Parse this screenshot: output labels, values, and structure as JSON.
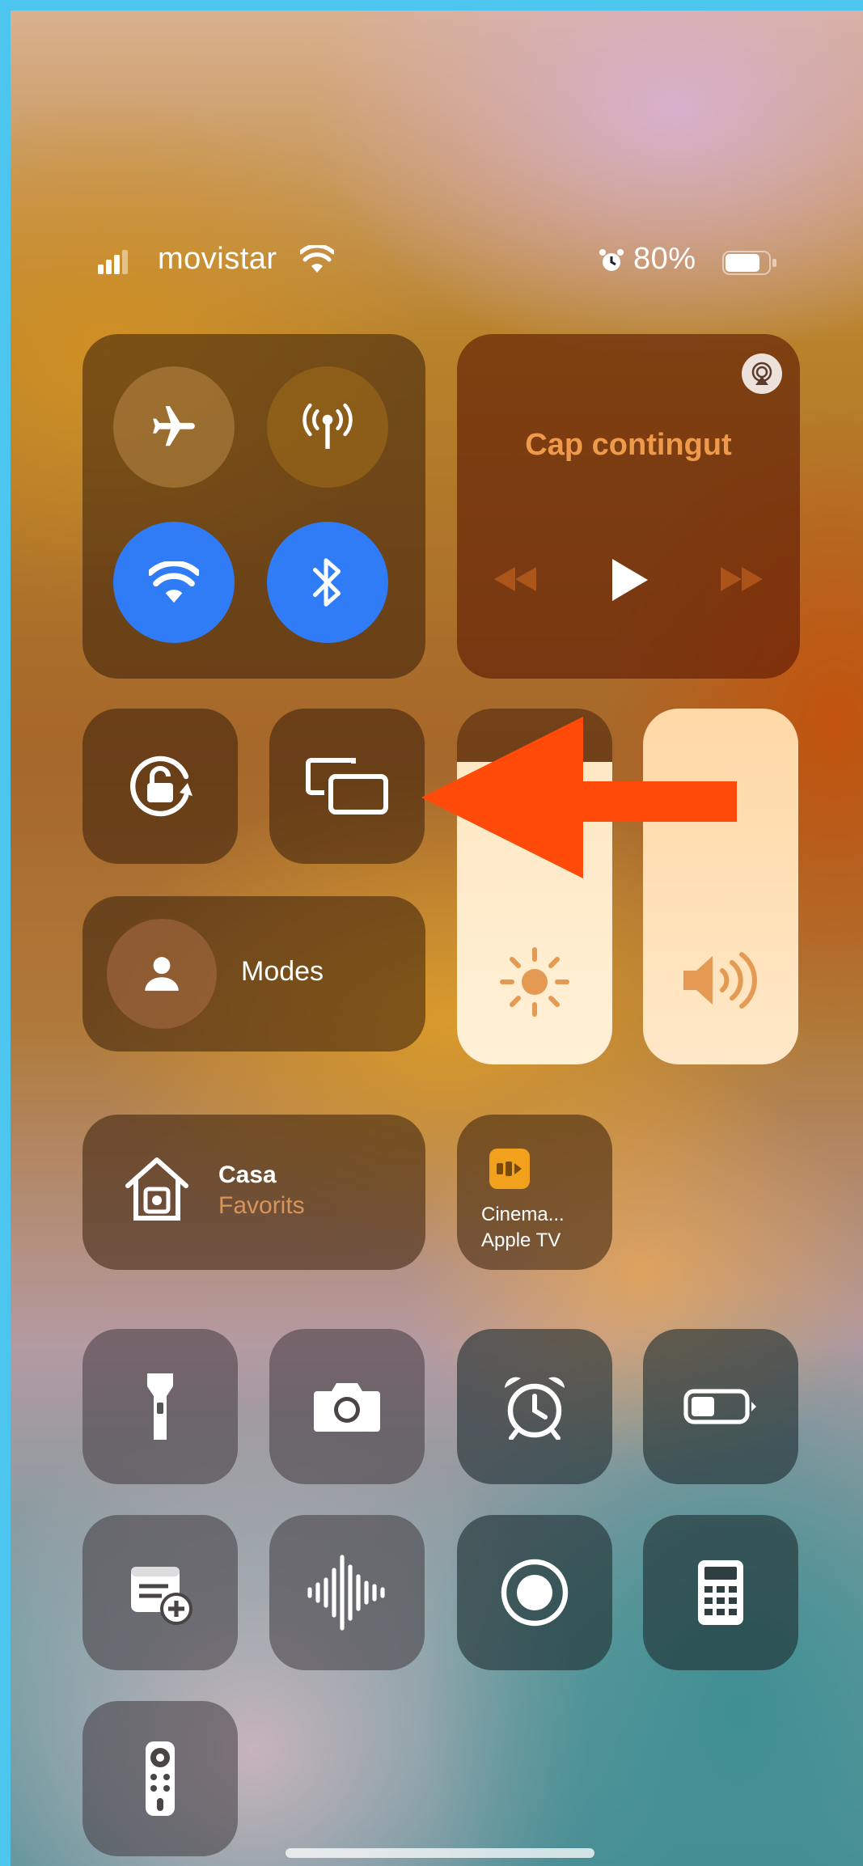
{
  "status_bar": {
    "carrier": "movistar",
    "battery_percent": "80%",
    "signal_bars": 3,
    "battery_level": 0.8
  },
  "connectivity": {
    "airplane_mode": false,
    "cellular_data": false,
    "wifi": true,
    "bluetooth": true,
    "active_color": "#2f7cf6"
  },
  "media": {
    "title": "Cap contingut",
    "title_color": "#ee9a4a"
  },
  "modes": {
    "label": "Modes"
  },
  "home": {
    "title": "Casa",
    "subtitle": "Favorits",
    "subtitle_color": "#d9945a"
  },
  "appletv": {
    "line1": "Cinema...",
    "line2": "Apple TV",
    "badge_color": "#f2a11d"
  },
  "sliders": {
    "brightness_level": 0.85,
    "volume_level": 1.0
  },
  "annotation": {
    "arrow_color": "#ff4a0a"
  }
}
